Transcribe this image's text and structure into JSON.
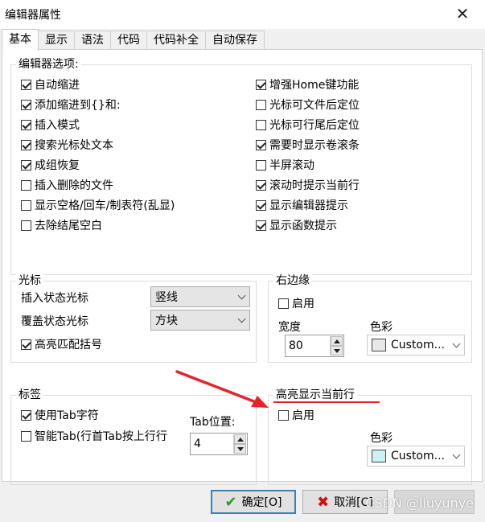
{
  "window": {
    "title": "编辑器属性",
    "close_glyph": "✕"
  },
  "tabs": [
    {
      "label": "基本",
      "active": true
    },
    {
      "label": "显示"
    },
    {
      "label": "语法"
    },
    {
      "label": "代码"
    },
    {
      "label": "代码补全"
    },
    {
      "label": "自动保存"
    }
  ],
  "editor_options": {
    "legend": "编辑器选项:",
    "left": [
      {
        "label": "自动缩进",
        "checked": true
      },
      {
        "label": "添加缩进到{}和:",
        "checked": true
      },
      {
        "label": "插入模式",
        "checked": true
      },
      {
        "label": "搜索光标处文本",
        "checked": true
      },
      {
        "label": "成组恢复",
        "checked": true
      },
      {
        "label": "插入删除的文件",
        "checked": false
      },
      {
        "label": "显示空格/回车/制表符(乱显)",
        "checked": false
      },
      {
        "label": "去除结尾空白",
        "checked": false
      }
    ],
    "right": [
      {
        "label": "增强Home键功能",
        "checked": true
      },
      {
        "label": "光标可文件后定位",
        "checked": false
      },
      {
        "label": "光标可行尾后定位",
        "checked": false
      },
      {
        "label": "需要时显示卷滚条",
        "checked": true
      },
      {
        "label": "半屏滚动",
        "checked": false
      },
      {
        "label": "滚动时提示当前行",
        "checked": true
      },
      {
        "label": "显示编辑器提示",
        "checked": true
      },
      {
        "label": "显示函数提示",
        "checked": true
      }
    ]
  },
  "cursor": {
    "legend": "光标",
    "insert_label": "插入状态光标",
    "insert_value": "竖线",
    "overwrite_label": "覆盖状态光标",
    "overwrite_value": "方块",
    "highlight_brackets": {
      "label": "高亮匹配括号",
      "checked": true
    }
  },
  "right_margin": {
    "legend": "右边缘",
    "enable": {
      "label": "启用",
      "checked": false
    },
    "width_label": "宽度",
    "width_value": "80",
    "color_label": "色彩",
    "color_value": "Custom...",
    "color_swatch": "#e8e8e8"
  },
  "tabs_group": {
    "legend": "标签",
    "use_tab": {
      "label": "使用Tab字符",
      "checked": true
    },
    "smart_tab": {
      "label": "智能Tab(行首Tab按上行行",
      "checked": false
    },
    "tab_pos_label": "Tab位置:",
    "tab_pos_value": "4"
  },
  "highlight_line": {
    "legend": "高亮显示当前行",
    "enable": {
      "label": "启用",
      "checked": false
    },
    "color_label": "色彩",
    "color_value": "Custom...",
    "color_swatch": "#ccf2f8"
  },
  "buttons": {
    "ok": "确定[O]",
    "cancel": "取消[C]"
  },
  "watermark": "CSDN @liuyunye",
  "colors": {
    "annotation": "#e8222a",
    "ok_icon": "#2a9d2a",
    "cancel_icon": "#d01010"
  }
}
